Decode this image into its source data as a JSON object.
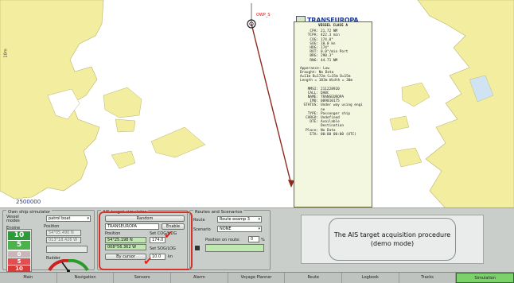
{
  "chart": {
    "own_ship_label": "OWP_S",
    "scale_label": "2500000",
    "side_label": "10m"
  },
  "vessel_popup": {
    "name": "TRANSEUROPA",
    "header": "VESSEL CLASS A",
    "rows": [
      {
        "k": "CPA:",
        "v": "21.72 NM"
      },
      {
        "k": "TCPA:",
        "v": "422.3 min"
      },
      {
        "k": "COG:",
        "v": "174.0°"
      },
      {
        "k": "SOG:",
        "v": "10.0 kn"
      },
      {
        "k": "HDG:",
        "v": "174°"
      },
      {
        "k": "ROT:",
        "v": "0.0°/min Port"
      },
      {
        "k": "BRG:",
        "v": "290.3°"
      },
      {
        "k": "RNG:",
        "v": "44.71 NM"
      }
    ],
    "block2": [
      "Apperance: Low",
      "  Draught: No Data",
      "A=11m  B=172m  C=15m  D=15m",
      "Length = 183m  Width = 30m"
    ],
    "rows2": [
      {
        "k": "MMSI:",
        "v": "211228920"
      },
      {
        "k": "CALL:",
        "v": "DABC"
      },
      {
        "k": "NAME:",
        "v": "TRANSEUROPA"
      },
      {
        "k": "IMO:",
        "v": "009010175"
      },
      {
        "k": "STATUS:",
        "v": "Under way using engi"
      },
      {
        "k": "",
        "v": "ne"
      },
      {
        "k": "TYPE:",
        "v": "Passenger ship"
      },
      {
        "k": "CARGO:",
        "v": "Undefined"
      },
      {
        "k": "DTE:",
        "v": "Available"
      },
      {
        "k": "",
        "v": "Destination"
      },
      {
        "k": "Place:",
        "v": "No Data"
      },
      {
        "k": "ETA:",
        "v": "00:00 00:00 (UTC)"
      }
    ]
  },
  "own_ship": {
    "title": "Own ship simulator",
    "vessel_modes_label": "Vessel modes",
    "vessel_mode_value": "patrol boat",
    "engine_label": "Engine",
    "position_label": "Position",
    "lat": "54°05.490 N",
    "lon": "013°18.426 W",
    "rudder_label": "Rudder",
    "gauge": {
      "top": "10",
      "mid": "5",
      "zero": "0",
      "neg5": "5",
      "neg10": "10"
    }
  },
  "ais": {
    "title": "AIS target simulator",
    "random_label": "Random",
    "target_name": "TRANSEUROPA",
    "enable_label": "Enable",
    "position_label": "Position",
    "set_cog_label": "Set COG/HDG",
    "lat": "54°25.198 N",
    "lon": "008°56.362 W",
    "cog_value": "174.0",
    "set_sog_label": "Set SOG/LOG",
    "by_cursor_label": "By cursor",
    "sog_value": "10.0",
    "sog_unit": "kn"
  },
  "routes": {
    "title": "Routes and Scenarios",
    "route_label": "Route",
    "route_value": "Route examp 3",
    "scenario_label": "Scenario",
    "scenario_value": "NONE",
    "position_on_route_label": "Position on route:",
    "position_on_route_value": "0",
    "percent": "%"
  },
  "demo_text": "The AIS target acquisition procedure (demo mode)",
  "tabs": [
    "Main",
    "Navigation",
    "Sensors",
    "Alarm",
    "Voyage Planner",
    "Route",
    "Logbook",
    "Tracks",
    "Simulation"
  ],
  "colors": {
    "land": "#f3ee9f",
    "land_dark": "#c9c86f",
    "water_inshore": "#cfe3f2",
    "track": "#8a2c1e",
    "highlight": "#d8302a",
    "active_tab": "#7bd26a"
  }
}
